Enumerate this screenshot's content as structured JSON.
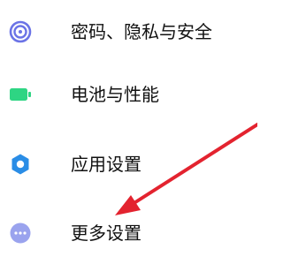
{
  "settings": {
    "items": [
      {
        "label": "密码、隐私与安全",
        "icon": "fingerprint-icon",
        "color": "#6b73e6"
      },
      {
        "label": "电池与性能",
        "icon": "battery-icon",
        "color": "#2ed583"
      },
      {
        "label": "应用设置",
        "icon": "gear-icon",
        "color": "#2a8de6"
      },
      {
        "label": "更多设置",
        "icon": "more-dots-icon",
        "color": "#9aa3ee"
      }
    ]
  },
  "annotation": {
    "arrow_color": "#e3232f",
    "arrow_icon": "red-arrow-icon"
  }
}
